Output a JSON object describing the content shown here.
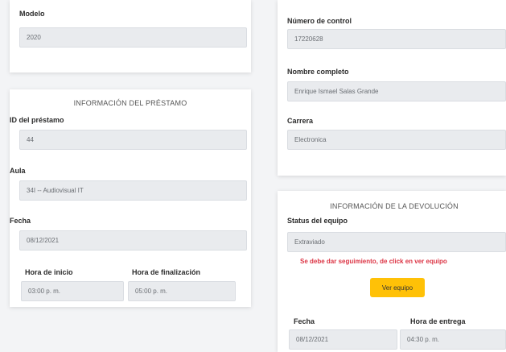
{
  "left": {
    "modelo": {
      "label": "Modelo",
      "value": "2020"
    },
    "prestamo": {
      "title": "INFORMACIÓN DEL PRÉSTAMO",
      "id": {
        "label": "ID del préstamo",
        "value": "44"
      },
      "aula": {
        "label": "Aula",
        "value": "34I -- Audiovisual IT"
      },
      "fecha": {
        "label": "Fecha",
        "value": "08/12/2021"
      },
      "hora_inicio": {
        "label": "Hora de inicio",
        "value": "03:00 p. m."
      },
      "hora_fin": {
        "label": "Hora de finalización",
        "value": "05:00 p. m."
      }
    }
  },
  "right": {
    "numero_control": {
      "label": "Número de control",
      "value": "17220628"
    },
    "nombre": {
      "label": "Nombre completo",
      "value": "Enrique Ismael Salas Grande"
    },
    "carrera": {
      "label": "Carrera",
      "value": "Electronica"
    },
    "devolucion": {
      "title": "INFORMACIÓN DE LA DEVOLUCIÓN",
      "status": {
        "label": "Status del equipo",
        "value": "Extraviado"
      },
      "warning": "Se debe dar seguimiento, de click en ver equipo",
      "button_label": "Ver equipo",
      "fecha": {
        "label": "Fecha",
        "value": "08/12/2021"
      },
      "hora_entrega": {
        "label": "Hora de entrega",
        "value": "04:30 p. m."
      }
    }
  },
  "colors": {
    "background": "#f3f4f6",
    "field": "#e9ebee",
    "warning": "#dc3545",
    "button": "#ffc107"
  }
}
